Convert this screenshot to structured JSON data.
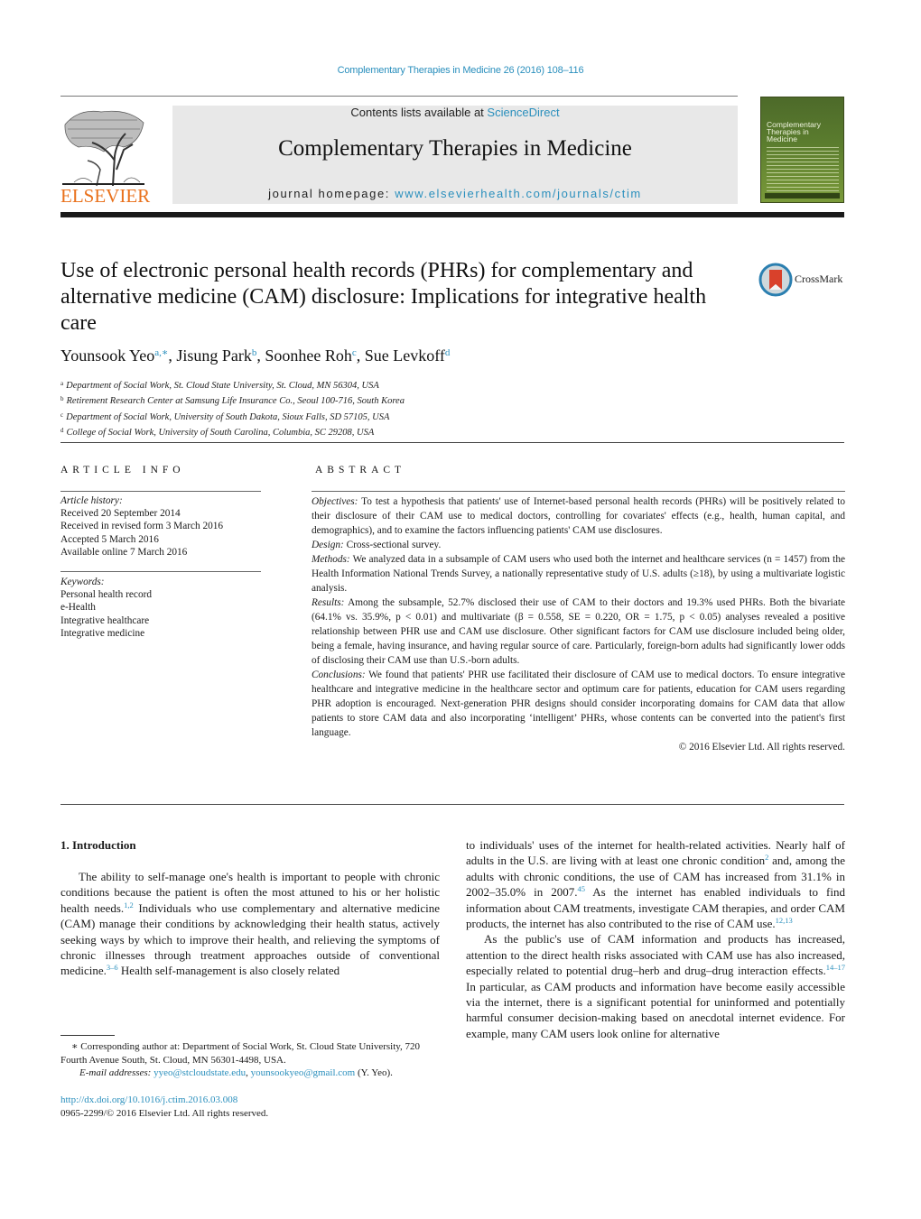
{
  "running_head": "Complementary Therapies in Medicine 26 (2016) 108–116",
  "masthead": {
    "publisher_logo_text": "ELSEVIER",
    "contents_prefix": "Contents lists available at ",
    "contents_link": "ScienceDirect",
    "journal_title": "Complementary Therapies in Medicine",
    "homepage_prefix": "journal homepage: ",
    "homepage_url": "www.elsevierhealth.com/journals/ctim",
    "cover_title": "Complementary\nTherapies in\nMedicine",
    "brand_color": "#e9711c",
    "link_color": "#2a8fbd"
  },
  "article": {
    "title": "Use of electronic personal health records (PHRs) for complementary and alternative medicine (CAM) disclosure: Implications for integrative health care",
    "crossmark_label": "CrossMark",
    "authors": [
      {
        "name": "Younsook Yeo",
        "marks": "a,∗"
      },
      {
        "name": "Jisung Park",
        "marks": "b"
      },
      {
        "name": "Soonhee Roh",
        "marks": "c"
      },
      {
        "name": "Sue Levkoff",
        "marks": "d"
      }
    ],
    "affiliations": [
      {
        "mark": "a",
        "text": "Department of Social Work, St. Cloud State University, St. Cloud, MN 56304, USA"
      },
      {
        "mark": "b",
        "text": "Retirement Research Center at Samsung Life Insurance Co., Seoul 100-716, South Korea"
      },
      {
        "mark": "c",
        "text": "Department of Social Work, University of South Dakota, Sioux Falls, SD 57105, USA"
      },
      {
        "mark": "d",
        "text": "College of Social Work, University of South Carolina, Columbia, SC 29208, USA"
      }
    ]
  },
  "article_info": {
    "heading": "ARTICLE INFO",
    "history_label": "Article history:",
    "history": [
      "Received 20 September 2014",
      "Received in revised form 3 March 2016",
      "Accepted 5 March 2016",
      "Available online 7 March 2016"
    ],
    "keywords_label": "Keywords:",
    "keywords": [
      "Personal health record",
      "e-Health",
      "Integrative healthcare",
      "Integrative medicine"
    ]
  },
  "abstract": {
    "heading": "ABSTRACT",
    "sections": [
      {
        "label": "Objectives:",
        "text": " To test a hypothesis that patients' use of Internet-based personal health records (PHRs) will be positively related to their disclosure of their CAM use to medical doctors, controlling for covariates' effects (e.g., health, human capital, and demographics), and to examine the factors influencing patients' CAM use disclosures."
      },
      {
        "label": "Design:",
        "text": " Cross-sectional survey."
      },
      {
        "label": "Methods:",
        "text": " We analyzed data in a subsample of CAM users who used both the internet and healthcare services (n = 1457) from the Health Information National Trends Survey, a nationally representative study of U.S. adults (≥18), by using a multivariate logistic analysis."
      },
      {
        "label": "Results:",
        "text": " Among the subsample, 52.7% disclosed their use of CAM to their doctors and 19.3% used PHRs. Both the bivariate (64.1% vs. 35.9%, p < 0.01) and multivariate (β = 0.558, SE = 0.220, OR = 1.75, p < 0.05) analyses revealed a positive relationship between PHR use and CAM use disclosure. Other significant factors for CAM use disclosure included being older, being a female, having insurance, and having regular source of care. Particularly, foreign-born adults had significantly lower odds of disclosing their CAM use than U.S.-born adults."
      },
      {
        "label": "Conclusions:",
        "text": " We found that patients' PHR use facilitated their disclosure of CAM use to medical doctors. To ensure integrative healthcare and integrative medicine in the healthcare sector and optimum care for patients, education for CAM users regarding PHR adoption is encouraged. Next-generation PHR designs should consider incorporating domains for CAM data that allow patients to store CAM data and also incorporating ‘intelligent’ PHRs, whose contents can be converted into the patient's first language."
      }
    ],
    "copyright": "© 2016 Elsevier Ltd. All rights reserved."
  },
  "body": {
    "section_heading": "1.  Introduction",
    "left_col": [
      {
        "t": "The ability to self-manage one's health is important to people with chronic conditions because the patient is often the most attuned to his or her holistic health needs."
      },
      {
        "ref": "1,2"
      },
      {
        "t": " Individuals who use complementary and alternative medicine (CAM) manage their conditions by acknowledging their health status, actively seeking ways by which to improve their health, and relieving the symptoms of chronic illnesses through treatment approaches outside of conventional medicine."
      },
      {
        "ref": "3–6"
      },
      {
        "t": " Health self-management is also closely related"
      }
    ],
    "right_p1": [
      {
        "t": "to individuals' uses of the internet for health-related activities. Nearly half of adults in the U.S. are living with at least one chronic condition"
      },
      {
        "ref": "2"
      },
      {
        "t": " and, among the adults with chronic conditions, the use of CAM has increased from 31.1% in 2002–35.0% in 2007."
      },
      {
        "ref": "45"
      },
      {
        "t": " As the internet has enabled individuals to find information about CAM treatments, investigate CAM therapies, and order CAM products, the internet has also contributed to the rise of CAM use."
      },
      {
        "ref": "12,13"
      }
    ],
    "right_p2": [
      {
        "t": "As the public's use of CAM information and products has increased, attention to the direct health risks associated with CAM use has also increased, especially related to potential drug–herb and drug–drug interaction effects."
      },
      {
        "ref": "14–17"
      },
      {
        "t": " In particular, as CAM products and information have become easily accessible via the internet, there is a significant potential for uninformed and potentially harmful consumer decision-making based on anecdotal internet evidence. For example, many CAM users look online for alternative"
      }
    ]
  },
  "footnotes": {
    "corresponding": "∗ Corresponding author at: Department of Social Work, St. Cloud State University, 720 Fourth Avenue South, St. Cloud, MN 56301-4498, USA.",
    "email_label": "E-mail addresses:",
    "emails": [
      "yyeo@stcloudstate.edu",
      "younsookyeo@gmail.com"
    ],
    "email_suffix": " (Y. Yeo).",
    "doi": "http://dx.doi.org/10.1016/j.ctim.2016.03.008",
    "issn_copyright": "0965-2299/© 2016 Elsevier Ltd. All rights reserved."
  }
}
